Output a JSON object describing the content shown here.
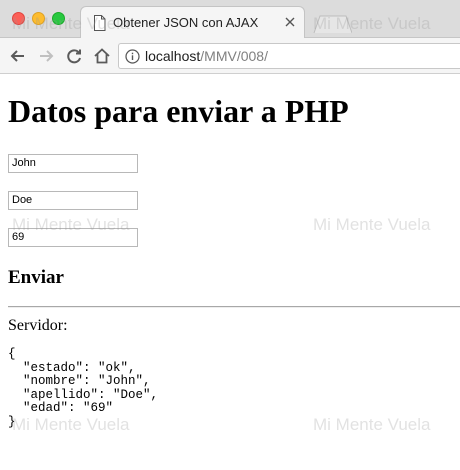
{
  "browser": {
    "tab_title": "Obtener JSON con AJAX",
    "url_host": "localhost",
    "url_path": "/MMV/008/"
  },
  "page": {
    "title": "Datos para enviar a PHP",
    "fields": [
      {
        "value": "John"
      },
      {
        "value": "Doe"
      },
      {
        "value": "69"
      }
    ],
    "send_label": "Enviar",
    "server_label": "Servidor:",
    "server_output": "{\n  \"estado\": \"ok\",\n  \"nombre\": \"John\",\n  \"apellido\": \"Doe\",\n  \"edad\": \"69\"\n}"
  },
  "watermark": {
    "text": "Mi Mente Vuela"
  },
  "colors": {
    "traffic_red": "#fc5f57",
    "traffic_yellow": "#fdbc2e",
    "traffic_green": "#28c840"
  }
}
